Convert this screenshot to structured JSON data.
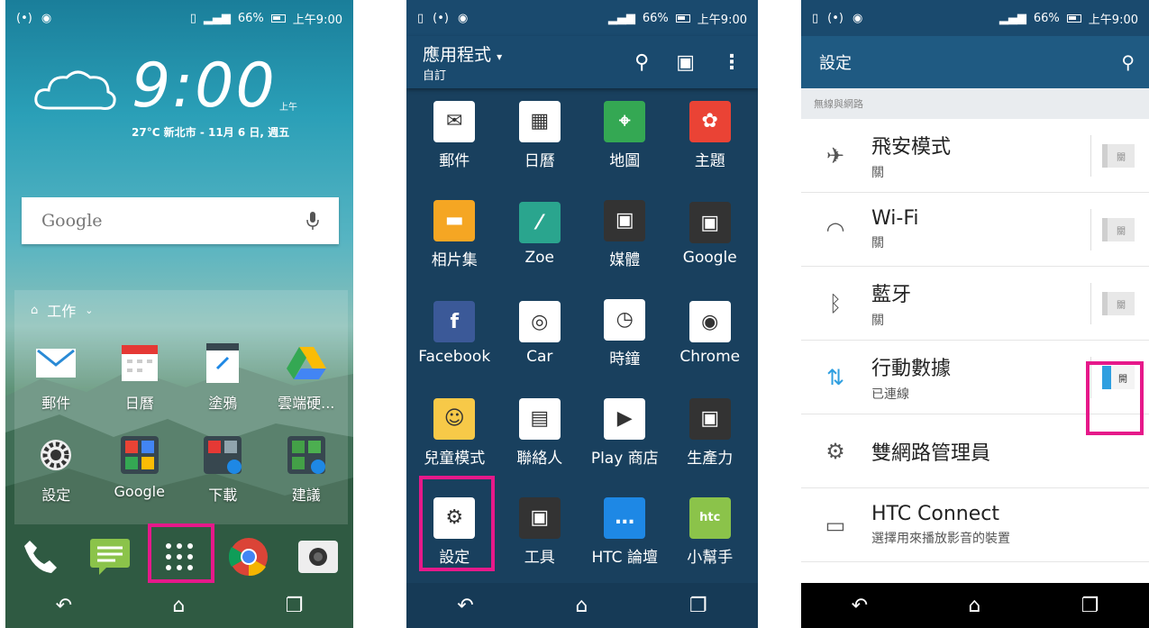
{
  "status": {
    "signal_left": "(•) ",
    "battery_percent": "66%",
    "time": "上午9:00"
  },
  "home": {
    "clock": "9:00",
    "ampm": "上午",
    "weather_line": "27°C 新北市 - 11月 6 日, 週五",
    "search_placeholder": "Google",
    "folder_title": "工作",
    "row1": [
      {
        "label": "郵件",
        "icon": "mail-icon"
      },
      {
        "label": "日曆",
        "icon": "calendar-icon"
      },
      {
        "label": "塗鴉",
        "icon": "notes-icon"
      },
      {
        "label": "雲端硬...",
        "icon": "drive-icon"
      }
    ],
    "row2": [
      {
        "label": "設定",
        "icon": "gear-icon"
      },
      {
        "label": "Google",
        "icon": "google-folder-icon"
      },
      {
        "label": "下載",
        "icon": "download-folder-icon"
      },
      {
        "label": "建議",
        "icon": "suggestion-folder-icon"
      }
    ],
    "dock": [
      "phone-icon",
      "messages-icon",
      "app-drawer-icon",
      "chrome-icon",
      "camera-icon"
    ]
  },
  "drawer": {
    "title": "應用程式",
    "subtitle": "自訂",
    "apps": [
      {
        "label": "郵件",
        "icon": "mail-icon",
        "color": "#ffffff"
      },
      {
        "label": "日曆",
        "icon": "calendar-icon",
        "color": "#ffffff"
      },
      {
        "label": "地圖",
        "icon": "maps-icon",
        "color": "#34a853"
      },
      {
        "label": "主題",
        "icon": "themes-icon",
        "color": "#ea4335"
      },
      {
        "label": "相片集",
        "icon": "gallery-icon",
        "color": "#f5a623"
      },
      {
        "label": "Zoe",
        "icon": "zoe-icon",
        "color": "#2aa58e"
      },
      {
        "label": "媒體",
        "icon": "media-icon",
        "color": "#333333"
      },
      {
        "label": "Google",
        "icon": "google-folder-icon",
        "color": "#333333"
      },
      {
        "label": "Facebook",
        "icon": "facebook-icon",
        "color": "#3b5998"
      },
      {
        "label": "Car",
        "icon": "car-icon",
        "color": "#ffffff"
      },
      {
        "label": "時鐘",
        "icon": "clock-icon",
        "color": "#ffffff"
      },
      {
        "label": "Chrome",
        "icon": "chrome-icon",
        "color": "#ffffff"
      },
      {
        "label": "兒童模式",
        "icon": "kids-mode-icon",
        "color": "#f7c948"
      },
      {
        "label": "聯絡人",
        "icon": "contacts-icon",
        "color": "#ffffff"
      },
      {
        "label": "Play 商店",
        "icon": "play-store-icon",
        "color": "#ffffff"
      },
      {
        "label": "生產力",
        "icon": "productivity-folder-icon",
        "color": "#333333"
      },
      {
        "label": "設定",
        "icon": "gear-icon",
        "color": "#ffffff"
      },
      {
        "label": "工具",
        "icon": "tools-folder-icon",
        "color": "#333333"
      },
      {
        "label": "HTC 論壇",
        "icon": "htc-forum-icon",
        "color": "#1e88e5"
      },
      {
        "label": "小幫手",
        "icon": "htc-helper-icon",
        "color": "#8bc34a"
      }
    ]
  },
  "settings": {
    "title": "設定",
    "section": "無線與網路",
    "rows": [
      {
        "title": "飛安模式",
        "sub": "關",
        "icon": "airplane-icon",
        "toggle": "關",
        "on": false
      },
      {
        "title": "Wi-Fi",
        "sub": "關",
        "icon": "wifi-icon",
        "toggle": "關",
        "on": false
      },
      {
        "title": "藍牙",
        "sub": "關",
        "icon": "bluetooth-icon",
        "toggle": "關",
        "on": false
      },
      {
        "title": "行動數據",
        "sub": "已連線",
        "icon": "mobile-data-icon",
        "toggle": "開",
        "on": true
      },
      {
        "title": "雙網路管理員",
        "sub": "",
        "icon": "dual-network-icon"
      },
      {
        "title": "HTC Connect",
        "sub": "選擇用來播放影音的裝置",
        "icon": "cast-icon"
      }
    ]
  },
  "colors": {
    "highlight": "#e6198a",
    "accent": "#2f9fe0",
    "appbar": "#1f5a82"
  }
}
